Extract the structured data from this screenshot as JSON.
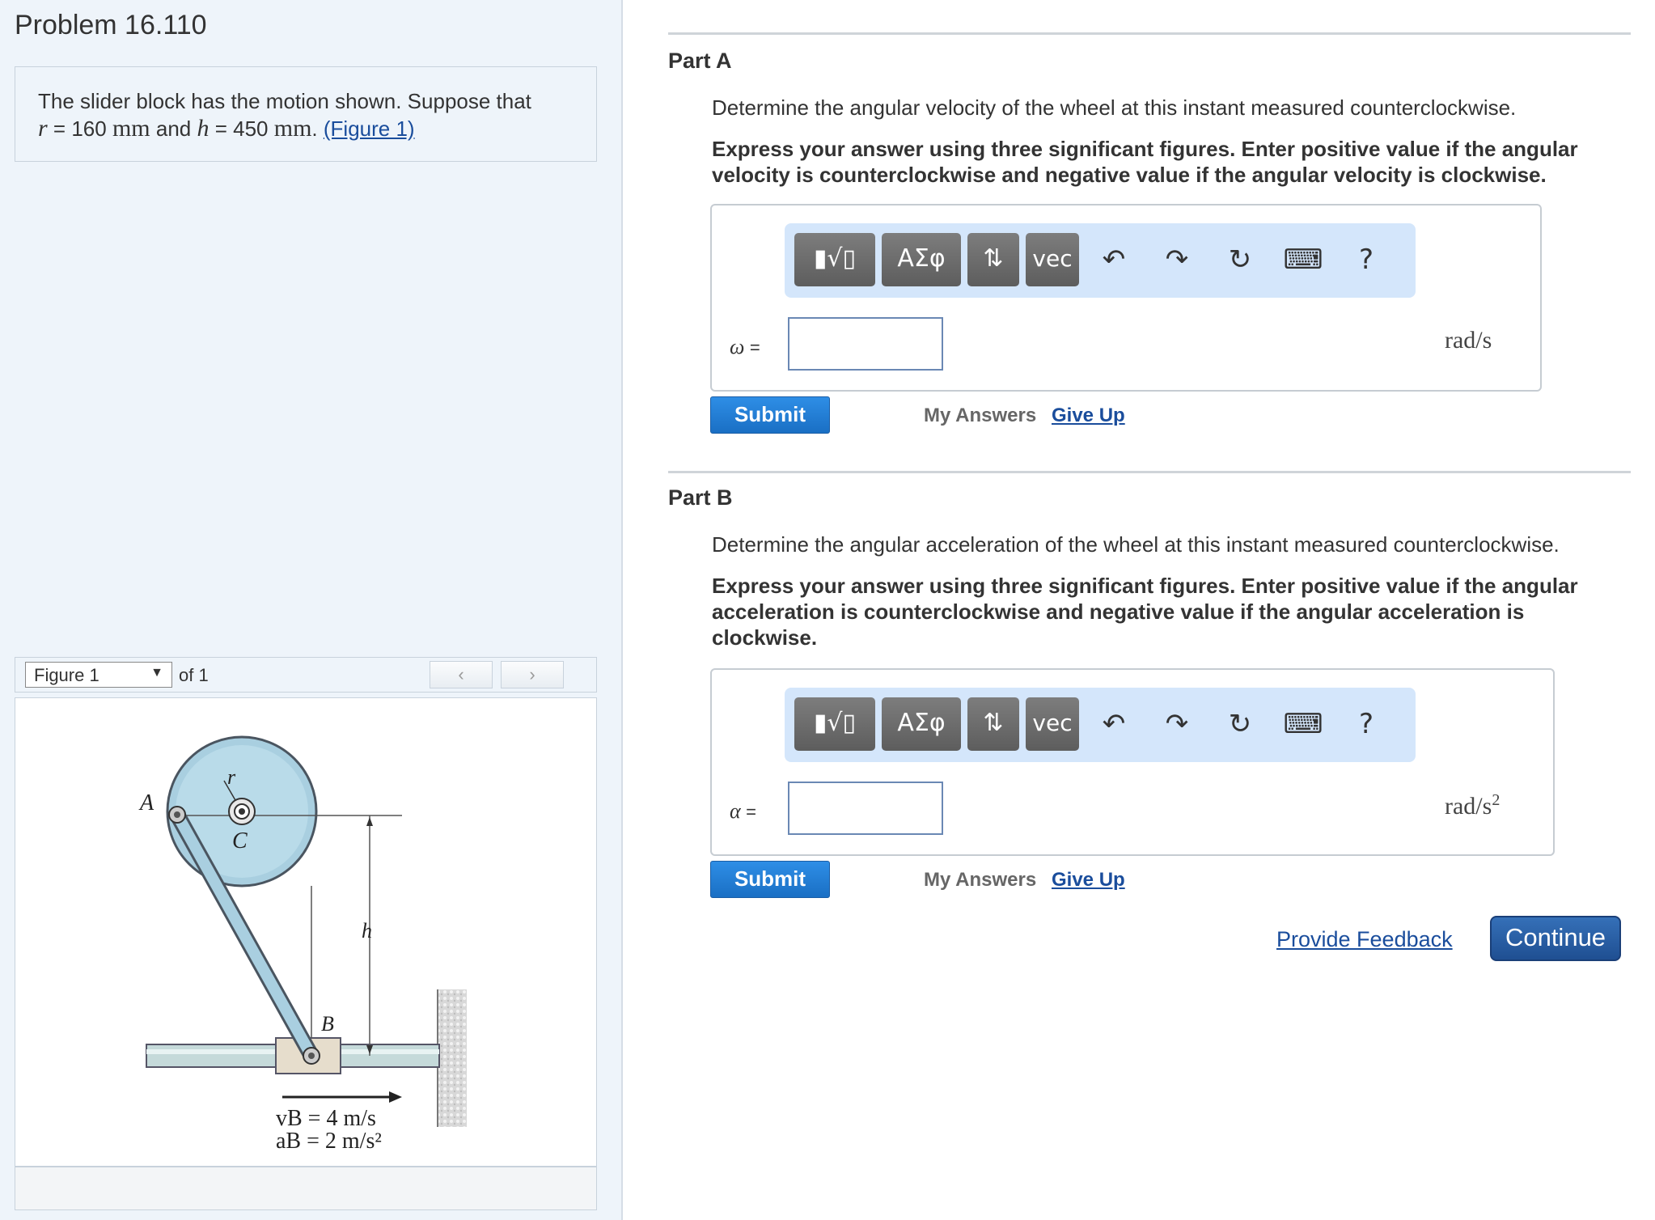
{
  "problem": {
    "title": "Problem 16.110",
    "text_before": "The slider block has the motion shown. Suppose that",
    "r_var": "r",
    "r_value": "160",
    "r_unit": "mm",
    "and_text": "and",
    "h_var": "h",
    "h_value": "450",
    "h_unit": "mm",
    "figure_link": "(Figure 1)"
  },
  "figure_panel": {
    "selected": "Figure 1",
    "of_text": "of 1",
    "prev": "‹",
    "next": "›",
    "labels": {
      "A": "A",
      "r": "r",
      "C": "C",
      "h": "h",
      "B": "B",
      "vB": "vB = 4 m/s",
      "aB": "aB = 2 m/s²"
    }
  },
  "toolbar": {
    "templates_icon": "▮√▯",
    "greek": "ΑΣφ",
    "arrows": "⇅",
    "vec": "vec",
    "undo": "↶",
    "redo": "↷",
    "reset": "↻",
    "keyboard": "⌨",
    "help": "?"
  },
  "part_a": {
    "title": "Part A",
    "description": "Determine the angular velocity of the wheel at this instant measured counterclockwise.",
    "instruction_1": "Express your answer using three significant figures. Enter positive value if the angular",
    "instruction_2": "velocity is counterclockwise and negative value if the angular velocity is clockwise.",
    "variable": "ω",
    "equals": "=",
    "value": "",
    "unit": "rad/s",
    "submit": "Submit",
    "my_answers": "My Answers",
    "give_up": "Give Up"
  },
  "part_b": {
    "title": "Part B",
    "description": "Determine the angular acceleration of the wheel at this instant measured counterclockwise.",
    "instruction_1": "Express your answer using three significant figures. Enter positive value if the angular",
    "instruction_2": "acceleration is counterclockwise and negative value if the angular acceleration is",
    "instruction_3": "clockwise.",
    "variable": "α",
    "equals": "=",
    "value": "",
    "unit": "rad/s",
    "unit_exp": "2",
    "submit": "Submit",
    "my_answers": "My Answers",
    "give_up": "Give Up"
  },
  "footer": {
    "feedback": "Provide Feedback",
    "continue": "Continue"
  }
}
